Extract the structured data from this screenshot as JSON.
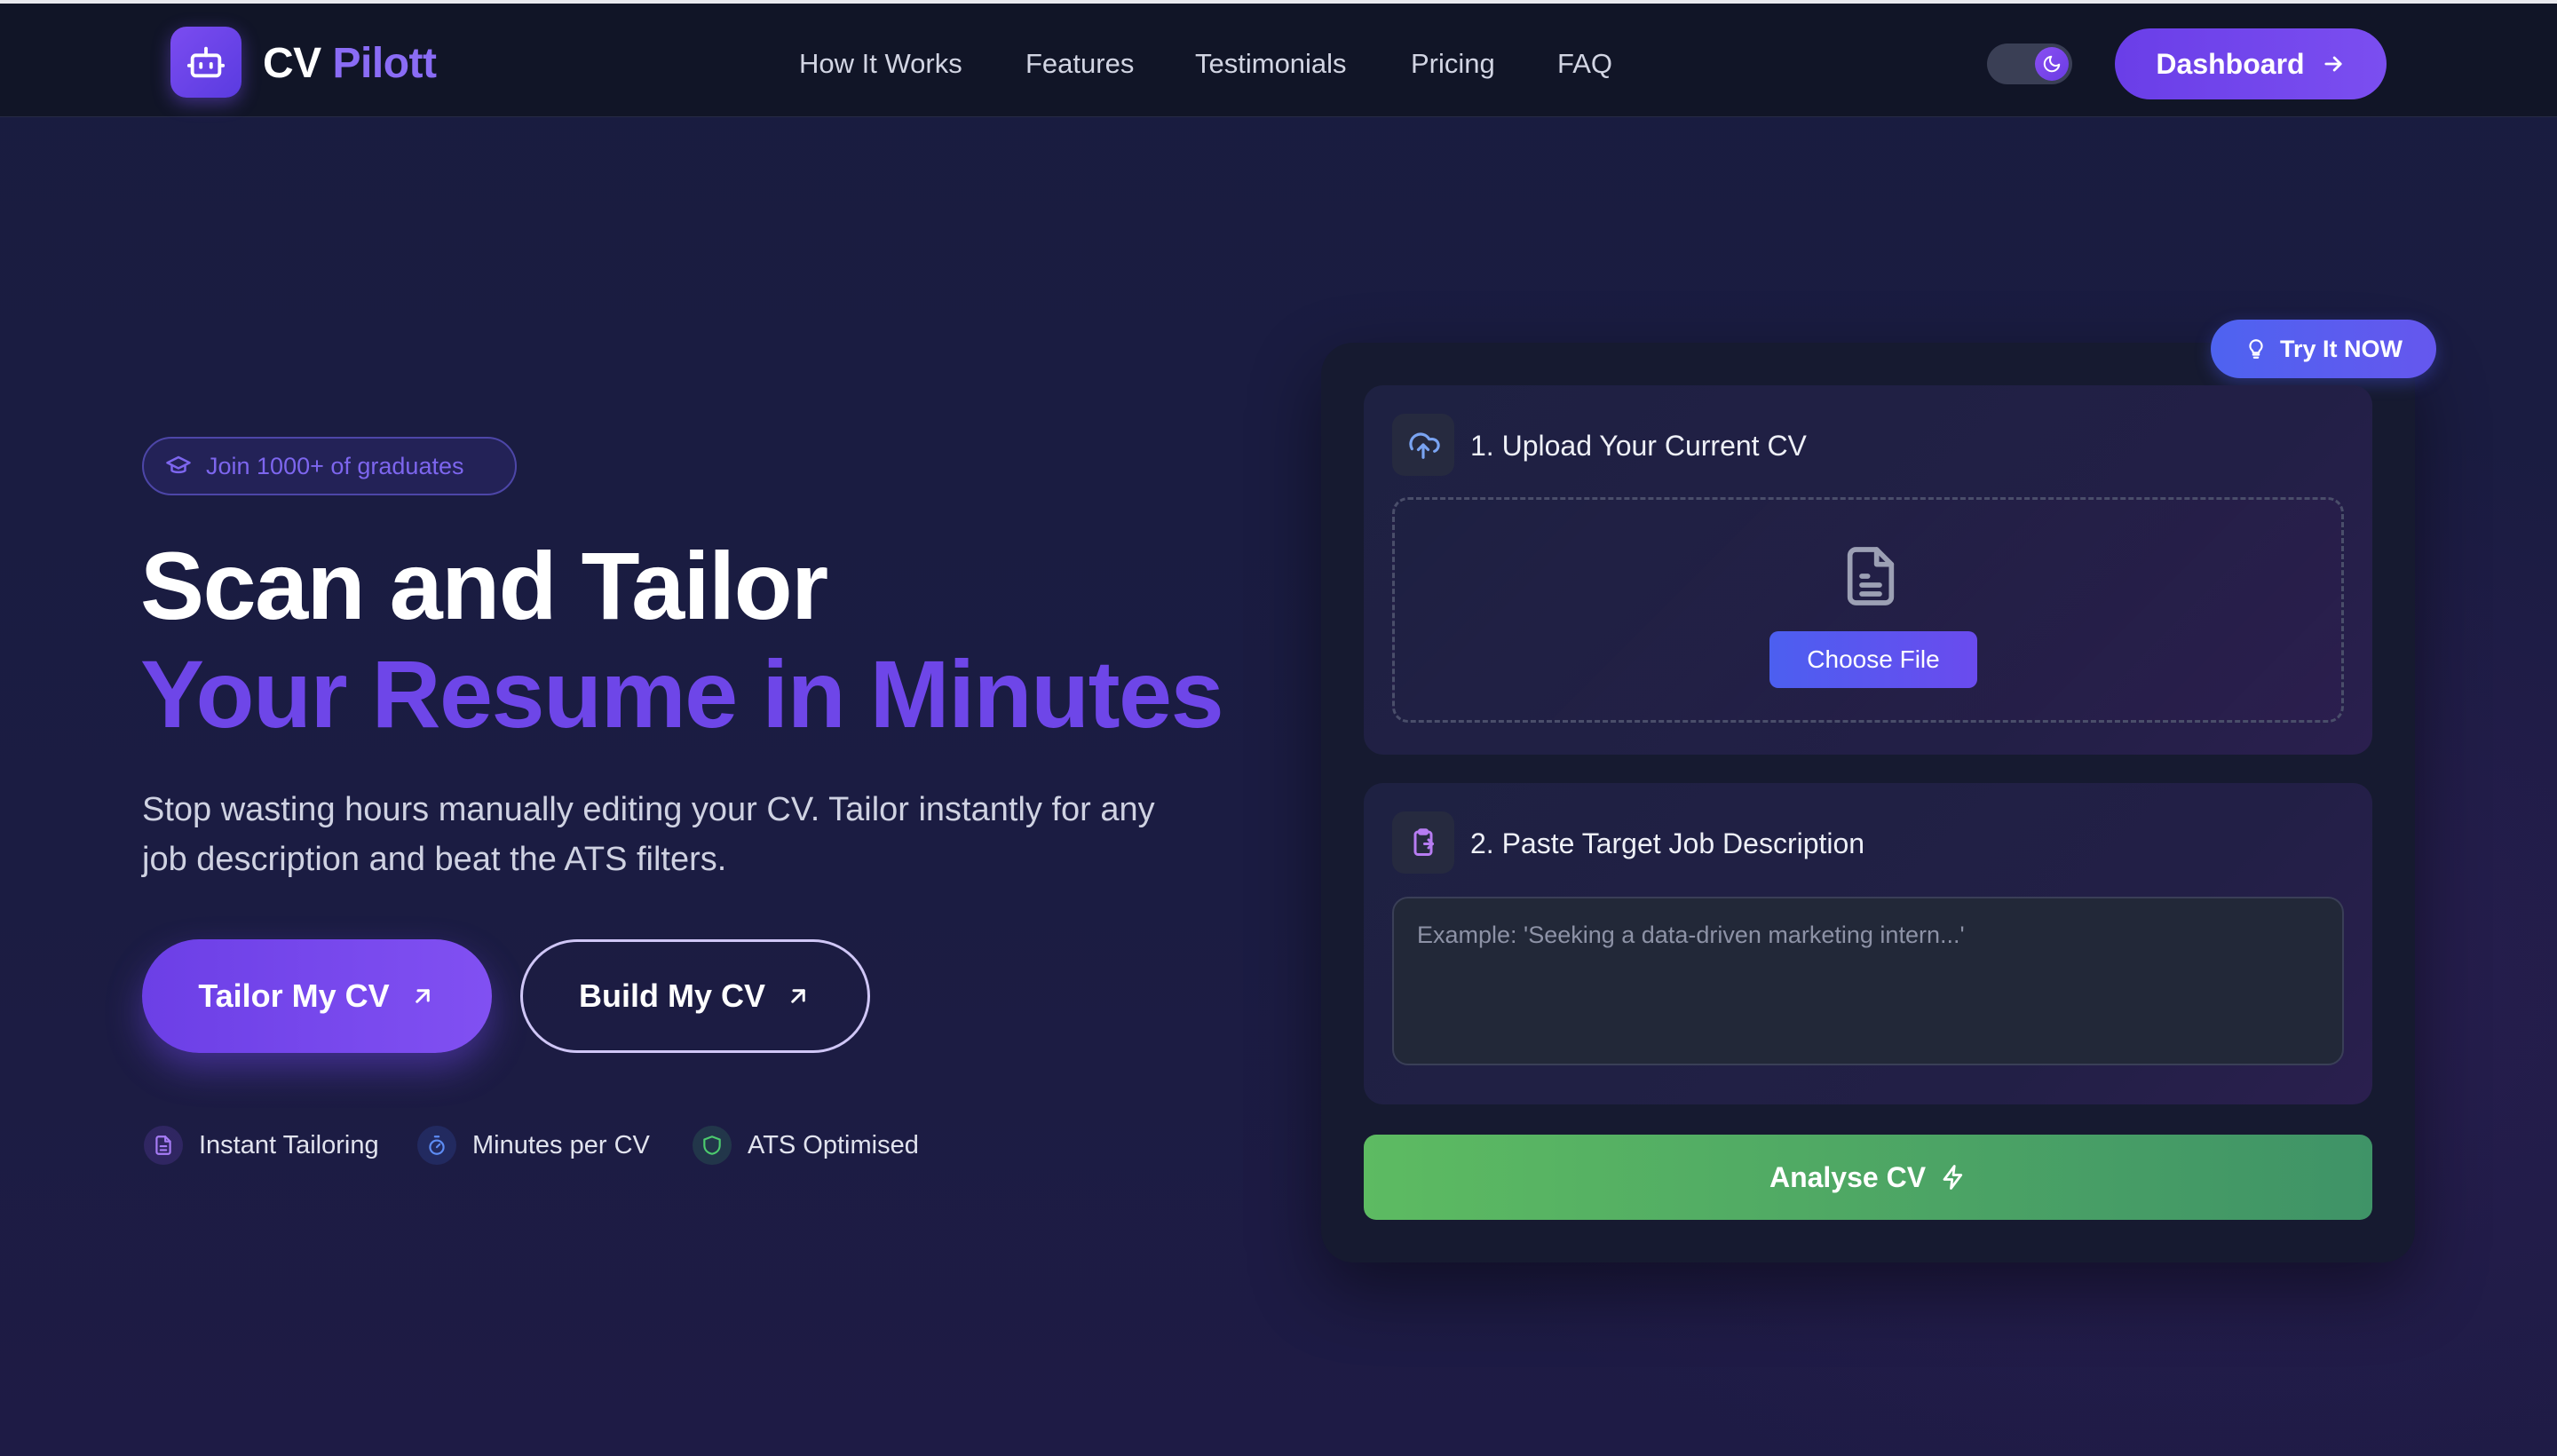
{
  "brand": {
    "part1": "CV",
    "part2": "Pilott"
  },
  "nav": {
    "items": [
      "How It Works",
      "Features",
      "Testimonials",
      "Pricing",
      "FAQ"
    ]
  },
  "header": {
    "dashboard_label": "Dashboard"
  },
  "hero": {
    "badge": "Join 1000+ of graduates",
    "title_line1": "Scan and Tailor",
    "title_line2": "Your Resume in Minutes",
    "subtitle": "Stop wasting hours manually editing your CV. Tailor instantly for any job description and beat the ATS filters.",
    "primary_cta": "Tailor My CV",
    "secondary_cta": "Build My CV",
    "features": [
      "Instant Tailoring",
      "Minutes per CV",
      "ATS Optimised"
    ]
  },
  "card": {
    "try_label": "Try It NOW",
    "step1_title": "1. Upload Your Current CV",
    "choose_file": "Choose File",
    "step2_title": "2. Paste Target Job Description",
    "job_placeholder": "Example: 'Seeking a data-driven marketing intern...'",
    "analyse_label": "Analyse CV"
  },
  "colors": {
    "accent": "#6e46e8",
    "nav_bg": "#111527",
    "analyse_green": "#5dbb62",
    "try_blue": "#4e63f0"
  }
}
